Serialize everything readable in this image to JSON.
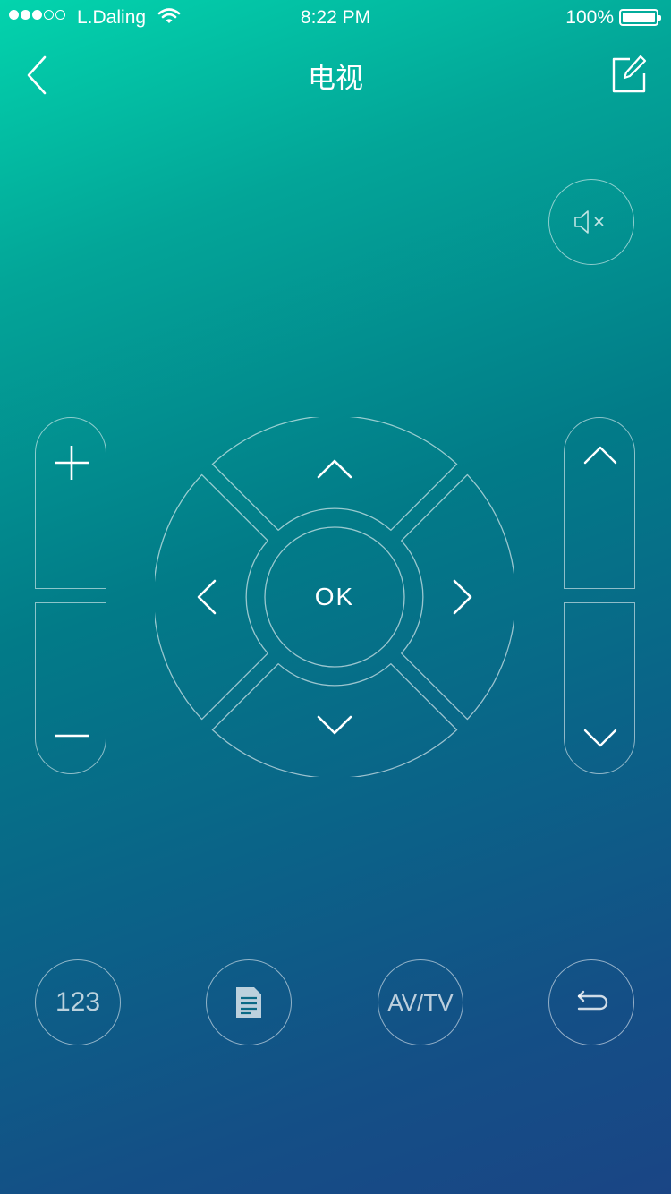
{
  "status_bar": {
    "carrier": "L.Daling",
    "time": "8:22 PM",
    "battery_percent": "100%",
    "signal_bars_filled": 3,
    "signal_bars_total": 5
  },
  "nav": {
    "title": "电视",
    "back_icon": "chevron-left-icon",
    "edit_icon": "edit-icon"
  },
  "mute": {
    "icon": "mute-icon"
  },
  "volume": {
    "up_icon": "plus-icon",
    "down_icon": "minus-icon"
  },
  "channel": {
    "up_icon": "chevron-up-icon",
    "down_icon": "chevron-down-icon"
  },
  "dpad": {
    "ok_label": "OK"
  },
  "bottom_buttons": {
    "numbers_label": "123",
    "menu_icon": "document-icon",
    "source_label": "AV/TV",
    "return_icon": "return-icon"
  },
  "colors": {
    "gradient_start": "#03d4ad",
    "gradient_mid": "#027b88",
    "gradient_end": "#1a4585",
    "line": "#ffffff"
  }
}
